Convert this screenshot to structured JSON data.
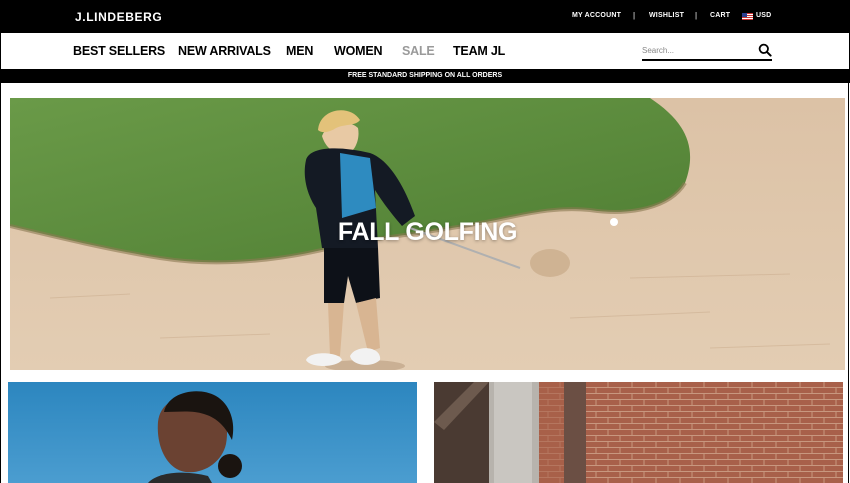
{
  "header": {
    "logo": "J.LINDEBERG",
    "utility": {
      "account": "MY ACCOUNT",
      "wishlist": "WISHLIST",
      "cart": "CART",
      "currency": "USD",
      "separator": "|"
    }
  },
  "nav": {
    "items": [
      {
        "label": "BEST SELLERS"
      },
      {
        "label": "NEW ARRIVALS"
      },
      {
        "label": "MEN"
      },
      {
        "label": "WOMEN"
      },
      {
        "label": "SALE"
      },
      {
        "label": "TEAM JL"
      }
    ],
    "sale_color": "#9a9a9a"
  },
  "search": {
    "placeholder": "Search...",
    "value": "",
    "icon": "search-icon"
  },
  "banner": {
    "text": "FREE STANDARD SHIPPING ON ALL ORDERS"
  },
  "hero": {
    "title": "FALL GOLFING"
  },
  "colors": {
    "black": "#000000",
    "sand": "#d9bfa3",
    "grass": "#5a8a3a",
    "sky": "#3c8fc4",
    "brick": "#a8604a"
  }
}
